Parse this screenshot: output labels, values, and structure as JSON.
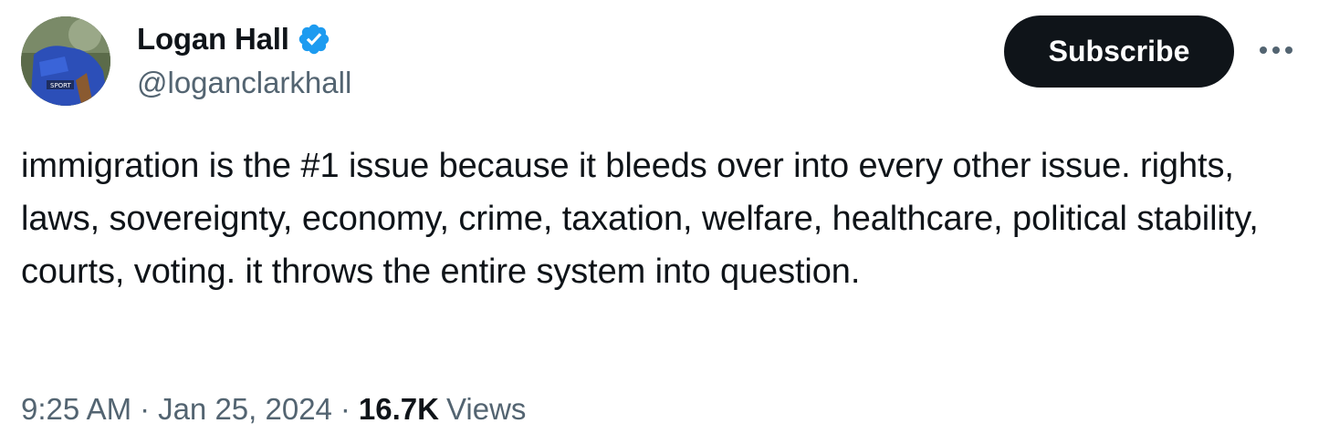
{
  "author": {
    "display_name": "Logan Hall",
    "handle": "@loganclarkhall",
    "verified": true,
    "avatar_icon": "profile-photo",
    "verified_icon": "verified-badge-icon",
    "verified_color": "#1d9bf0"
  },
  "actions": {
    "subscribe_label": "Subscribe",
    "more_icon": "more-horizontal-icon"
  },
  "tweet": {
    "text": "immigration is the #1 issue because it bleeds over into every other issue. rights, laws, sovereignty, economy, crime, taxation, welfare, healthcare, political stability, courts, voting. it throws the entire system into question."
  },
  "meta": {
    "time": "9:25 AM",
    "separator": "·",
    "date": "Jan 25, 2024",
    "views_count": "16.7K",
    "views_label": "Views"
  },
  "colors": {
    "text_primary": "#0f1419",
    "text_secondary": "#536471",
    "button_bg": "#0f1419",
    "button_text": "#ffffff"
  }
}
